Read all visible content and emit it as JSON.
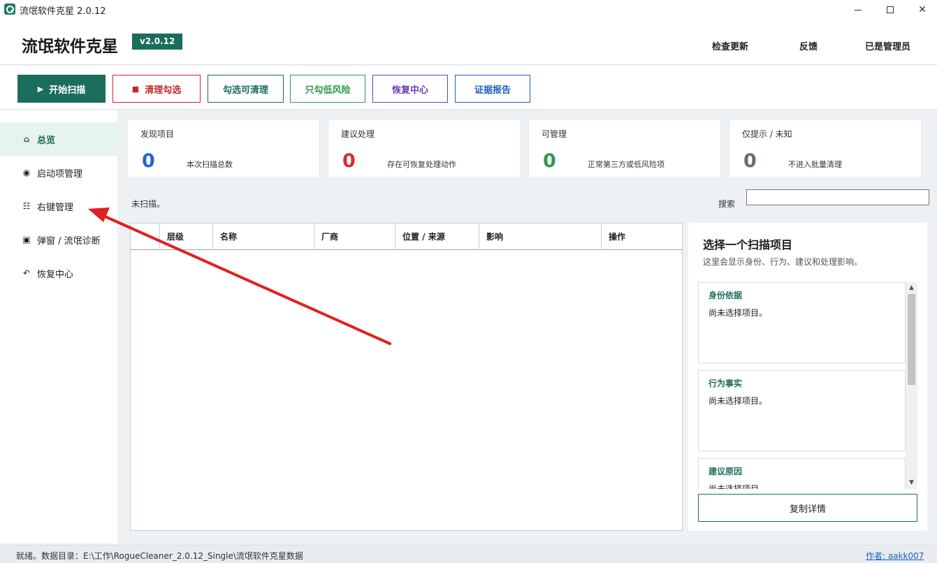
{
  "window": {
    "title": "流氓软件克星 2.0.12",
    "controls": {
      "minimize": "minimize-icon",
      "maximize": "maximize-icon",
      "close": "close-icon"
    }
  },
  "header": {
    "brand": "流氓软件克星",
    "version": "v2.0.12",
    "links": [
      "检查更新",
      "反馈",
      "已是管理员"
    ]
  },
  "toolbar": {
    "buttons": [
      {
        "label": "开始扫描",
        "icon": "play-icon",
        "color": "#1b6d5c"
      },
      {
        "label": "清理勾选",
        "icon": "stop-icon",
        "color": "#c62828"
      },
      {
        "label": "勾选可清理",
        "color": "#1b6d5c"
      },
      {
        "label": "只勾低风险",
        "color": "#2e9a4a"
      },
      {
        "label": "恢复中心",
        "color": "#6a3fb5"
      },
      {
        "label": "证据报告",
        "color": "#1f5fbf"
      }
    ]
  },
  "sidebar": {
    "items": [
      {
        "label": "总览",
        "icon": "home-icon",
        "active": true
      },
      {
        "label": "启动项管理",
        "icon": "radio-dot-icon"
      },
      {
        "label": "右键管理",
        "icon": "list-icon"
      },
      {
        "label": "弹窗 / 流氓诊断",
        "icon": "window-icon"
      },
      {
        "label": "恢复中心",
        "icon": "undo-icon"
      }
    ]
  },
  "stats": [
    {
      "label": "发现项目",
      "value": "0",
      "desc": "本次扫描总数",
      "color": "#2563d6"
    },
    {
      "label": "建议处理",
      "value": "0",
      "desc": "存在可恢复处理动作",
      "color": "#d32f2f"
    },
    {
      "label": "可管理",
      "value": "0",
      "desc": "正常第三方或低风险项",
      "color": "#2e9a4a"
    },
    {
      "label": "仅提示 / 未知",
      "value": "0",
      "desc": "不进入批量清理",
      "color": "#5f6f80"
    }
  ],
  "main": {
    "scan_status": "未扫描。",
    "search_label": "搜索",
    "search_value": ""
  },
  "table": {
    "columns": [
      "",
      "层级",
      "名称",
      "厂商",
      "位置 / 来源",
      "影响",
      "操作"
    ],
    "rows": []
  },
  "detail": {
    "title": "选择一个扫描项目",
    "subtitle": "这里会显示身份、行为、建议和处理影响。",
    "cards": [
      {
        "title": "身份依据",
        "body": "尚未选择项目。"
      },
      {
        "title": "行为事实",
        "body": "尚未选择项目。"
      },
      {
        "title": "建议原因",
        "body": "尚未选择项目。"
      }
    ],
    "copy_button": "复制详情"
  },
  "statusbar": {
    "text": "就绪。数据目录：E:\\工作\\RogueCleaner_2.0.12_Single\\流氓软件克星数据",
    "author": "作者: aakk007"
  },
  "annotation": {
    "color": "#e02020"
  }
}
